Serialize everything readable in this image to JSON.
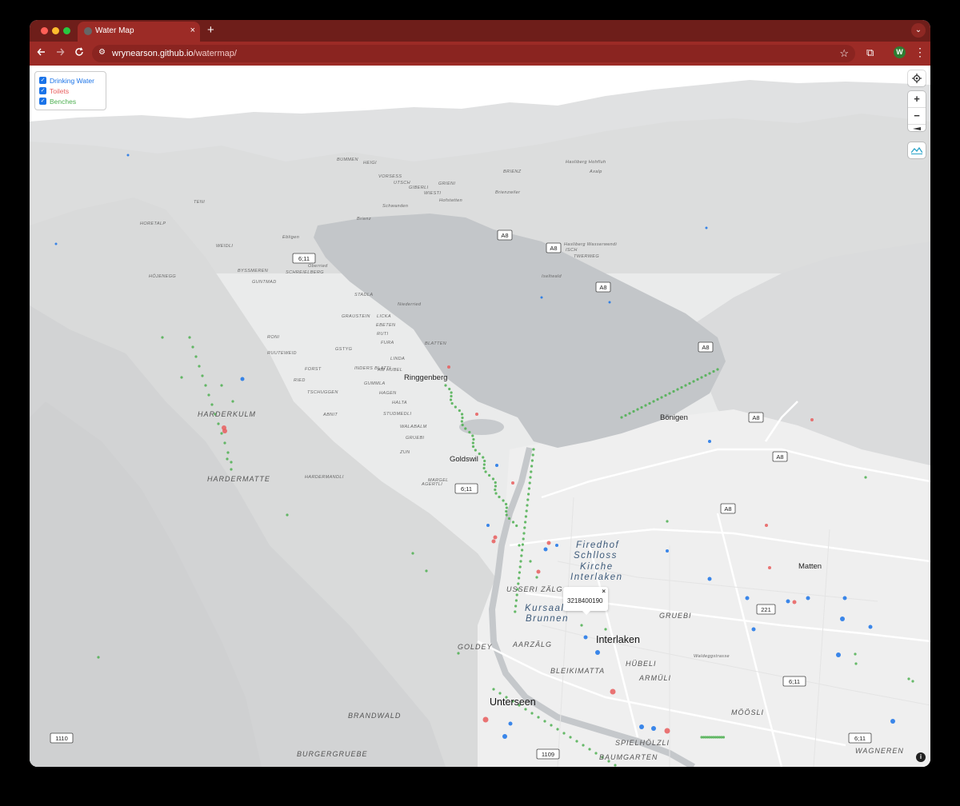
{
  "browser": {
    "tab_title": "Water Map",
    "tab_close": "×",
    "new_tab": "+",
    "tab_menu": "⌄",
    "url_host": "wrynearson.github.io",
    "url_path": "/watermap/",
    "profile_initial": "W",
    "colors": {
      "tabbar": "#6e1e1a",
      "toolbar": "#9c2b26"
    }
  },
  "legend": {
    "items": [
      {
        "label": "Drinking Water",
        "color": "#1a73e8",
        "checked": true
      },
      {
        "label": "Toilets",
        "color": "#e85d5d",
        "checked": true
      },
      {
        "label": "Benches",
        "color": "#4caf50",
        "checked": true
      }
    ]
  },
  "controls": {
    "zoom_in": "+",
    "zoom_out": "−"
  },
  "popup": {
    "id": "3218400190",
    "close": "×"
  },
  "attribution_icon": "i",
  "map": {
    "labels_small": [
      "BUMMEN",
      "HEIGI",
      "VORSESS",
      "UTSCH",
      "GIBERLI",
      "WIESTI",
      "GRIENI",
      "BRIENZ",
      "Brienzwiler",
      "Hofstetten",
      "Schwanden",
      "Brienz",
      "Ebligen",
      "Oberried",
      "Hasliberg Wasserwendi",
      "Hasliberg Hohfluh",
      "Axalp",
      "Niederried",
      "Iseltwald",
      "ISCH",
      "TWERWEG",
      "STADLA",
      "GRAUSTEIN",
      "LICKA",
      "EBETEN",
      "RUTI",
      "FURA",
      "BLATTEN",
      "LINDA",
      "GSTYG",
      "INDERS BLATTI",
      "AM HUBEL",
      "GUMMLA",
      "HAGEN",
      "HALTA",
      "STUDMEDLI",
      "WALABALM",
      "GRUEBI",
      "ZUN",
      "AGERTLI",
      "MARGEL",
      "BYSSMEREN",
      "GUNTMAD",
      "SCHREIELBERG",
      "WEIDLI",
      "TENI",
      "HORETALP",
      "HÖJENEGG",
      "RONI",
      "RUUTEWEID",
      "RIED",
      "FORST",
      "TSCHUGGEN",
      "ABNIT",
      "HARDERMANDLI",
      "Waldeggstrasse"
    ],
    "labels_medium": [
      "Ringgenberg",
      "Goldswil",
      "Bönigen",
      "Matten",
      "HARDERKULM",
      "HARDERMATTE",
      "USSERI ZÄLG",
      "GOLDEY",
      "AARZÄLG",
      "BLEIKIMATTA",
      "HÜBELI",
      "ARMÜLI",
      "GRUEBI",
      "MÖÖSLI",
      "SPIELHÖLZLI",
      "BAUMGARTEN",
      "WAGNEREN",
      "BRANDWALD",
      "BURGERGRUEBE"
    ],
    "labels_large": [
      "Interlaken",
      "Unterseen"
    ],
    "labels_blue": [
      "Firedhof",
      "Schlloss",
      "Kirche",
      "Interlaken",
      "Kursaal",
      "Brunnen"
    ],
    "road_shields": [
      "A8",
      "6;11",
      "221",
      "1110",
      "1109"
    ]
  }
}
